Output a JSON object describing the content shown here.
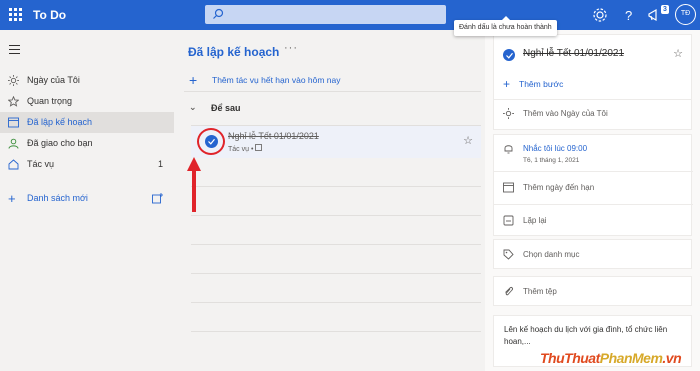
{
  "header": {
    "app_title": "To Do",
    "search_placeholder": "",
    "notification_count": "3",
    "avatar_initials": "TĐ",
    "tooltip": "Đánh dấu là chưa hoàn thành"
  },
  "sidebar": {
    "items": [
      {
        "label": "Ngày của Tôi",
        "icon": "sun-icon"
      },
      {
        "label": "Quan trọng",
        "icon": "star-icon"
      },
      {
        "label": "Đã lập kế hoạch",
        "icon": "calendar-icon"
      },
      {
        "label": "Đã giao cho bạn",
        "icon": "person-icon"
      },
      {
        "label": "Tác vụ",
        "icon": "home-icon",
        "count": "1"
      }
    ],
    "new_list_label": "Danh sách mới"
  },
  "main": {
    "title": "Đã lập kế hoạch",
    "more": "···",
    "add_task_label": "Thêm tác vụ hết hạn vào hôm nay",
    "group_label": "Để sau",
    "task": {
      "title": "Nghỉ lễ Tết 01/01/2021",
      "meta": "Tác vụ"
    }
  },
  "detail": {
    "title": "Nghỉ lễ Tết 01/01/2021",
    "add_step": "Thêm bước",
    "add_my_day": "Thêm vào Ngày của Tôi",
    "remind": "Nhắc tôi lúc 09:00",
    "remind_date": "T6, 1 tháng 1, 2021",
    "due_date": "Thêm ngày đến hạn",
    "repeat": "Lặp lại",
    "category": "Chọn danh mục",
    "attach": "Thêm tệp",
    "note": "Lên kế hoạch du lịch với gia đình, tổ chức liên hoan,..."
  },
  "watermark": {
    "part1": "ThuThuat",
    "part2": "PhanMem",
    "part3": ".vn"
  },
  "colors": {
    "accent": "#2564cf",
    "highlight": "#e0242a"
  }
}
